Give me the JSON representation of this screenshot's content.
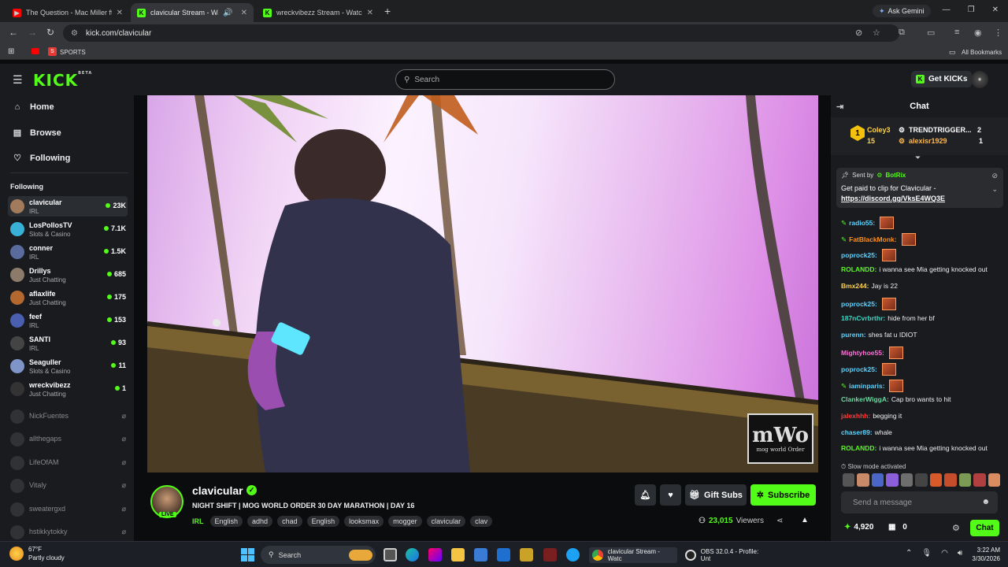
{
  "browser": {
    "tabs": [
      {
        "title": "The Question - Mac Miller ft. Li",
        "active": false
      },
      {
        "title": "clavicular Stream - Watch Li",
        "active": true
      },
      {
        "title": "wreckvibezz Stream - Watch Liv",
        "active": false
      }
    ],
    "ask_gemini": "Ask Gemini",
    "url": "kick.com/clavicular",
    "bookmarks": {
      "sports": "SPORTS",
      "all": "All Bookmarks"
    }
  },
  "kick": {
    "logo": "KICK",
    "logo_badge": "BETA",
    "search_placeholder": "Search",
    "get_kicks": "Get KICKs"
  },
  "sidebar": {
    "nav": [
      {
        "label": "Home",
        "icon": "home-icon"
      },
      {
        "label": "Browse",
        "icon": "browse-icon"
      },
      {
        "label": "Following",
        "icon": "heart-icon"
      }
    ],
    "following_title": "Following",
    "channels": [
      {
        "name": "clavicular",
        "category": "IRL",
        "viewers": "23K",
        "color": "#a27a5c"
      },
      {
        "name": "LosPollosTV",
        "category": "Slots & Casino",
        "viewers": "7.1K",
        "color": "#39b0d6"
      },
      {
        "name": "conner",
        "category": "IRL",
        "viewers": "1.5K",
        "color": "#5a6b9e"
      },
      {
        "name": "Drillys",
        "category": "Just Chatting",
        "viewers": "685",
        "color": "#8c7a6a"
      },
      {
        "name": "aflaxlife",
        "category": "Just Chatting",
        "viewers": "175",
        "color": "#b3682f"
      },
      {
        "name": "feef",
        "category": "IRL",
        "viewers": "153",
        "color": "#4a5fb0"
      },
      {
        "name": "SANTI",
        "category": "IRL",
        "viewers": "93",
        "color": "#444444"
      },
      {
        "name": "Seaguller",
        "category": "Slots & Casino",
        "viewers": "11",
        "color": "#7f95c7"
      },
      {
        "name": "wreckvibezz",
        "category": "Just Chatting",
        "viewers": "1",
        "color": "#333333"
      }
    ],
    "offline": [
      "NickFuentes",
      "allthegaps",
      "LifeOfAM",
      "Vitaly",
      "sweatergxd",
      "hstikkytokky"
    ]
  },
  "stream": {
    "channel": "clavicular",
    "live": "LIVE",
    "title": "NIGHT SHIFT | MOG WORLD ORDER 30 DAY MARATHON | DAY 16",
    "category": "IRL",
    "tags": [
      "English",
      "adhd",
      "chad",
      "English",
      "looksmax",
      "mogger",
      "clavicular",
      "clav"
    ],
    "gift_subs": "Gift Subs",
    "subscribe": "Subscribe",
    "viewers": "23,015",
    "viewers_label": "Viewers",
    "watermark_big": "mWo",
    "watermark_small": "mog world Order"
  },
  "chat": {
    "title": "Chat",
    "leaderboard": {
      "rank": "1",
      "left_user": "Coley3",
      "left_count": "15",
      "right_user1": "TRENDTRIGGER...",
      "right_count1": "2",
      "right_user2": "alexisr1929",
      "right_count2": "1"
    },
    "pinned": {
      "sent_by": "Sent by",
      "bot": "BotRix",
      "text": "Get paid to clip for Clavicular -",
      "link": "https://discord.gg/VksE4WQ3E"
    },
    "messages": [
      {
        "user": "radio55:",
        "text": "",
        "color": "#5cd3ff",
        "emote": true,
        "icon": true
      },
      {
        "user": "FatBlackMonk:",
        "text": "",
        "color": "#ff8f1f",
        "emote": true,
        "icon": true
      },
      {
        "user": "poprock25:",
        "text": "",
        "color": "#5cd3ff",
        "emote": true
      },
      {
        "user": "ROLANDD:",
        "text": "i wanna see Mia getting knocked out",
        "color": "#53fc18"
      },
      {
        "user": "Bmx244:",
        "text": "Jay is 22",
        "color": "#ffd24a"
      },
      {
        "user": "poprock25:",
        "text": "",
        "color": "#5cd3ff",
        "emote": true
      },
      {
        "user": "187nCvrbrthr:",
        "text": "hide from her bf",
        "color": "#3fd6c4"
      },
      {
        "user": "purenn:",
        "text": "shes fat u IDIOT",
        "color": "#5cd3ff"
      },
      {
        "user": "Mightyhoe55:",
        "text": "",
        "color": "#ff6fd8",
        "emote": true
      },
      {
        "user": "poprock25:",
        "text": "",
        "color": "#5cd3ff",
        "emote": true
      },
      {
        "user": "iaminparis:",
        "text": "",
        "color": "#5cd3ff",
        "emote": true,
        "icon": true
      },
      {
        "user": "ClankerWiggA:",
        "text": "Cap bro wants to hit",
        "color": "#6dd7a0"
      },
      {
        "user": "jalexhhh:",
        "text": "begging it",
        "color": "#ff3b3b"
      },
      {
        "user": "chaser89:",
        "text": "whale",
        "color": "#5cd3ff"
      },
      {
        "user": "ROLANDD:",
        "text": "i wanna see Mia getting knocked out",
        "color": "#53fc18"
      }
    ],
    "slow_mode": "Slow mode activated",
    "input_placeholder": "Send a message",
    "points": "4,920",
    "gifts": "0",
    "send": "Chat"
  },
  "taskbar": {
    "temp": "67°F",
    "weather": "Partly cloudy",
    "search": "Search",
    "browser_app": "clavicular Stream - Watc",
    "obs_app": "OBS 32.0.4 - Profile: Unt",
    "time": "3:22 AM",
    "date": "3/30/2026"
  }
}
